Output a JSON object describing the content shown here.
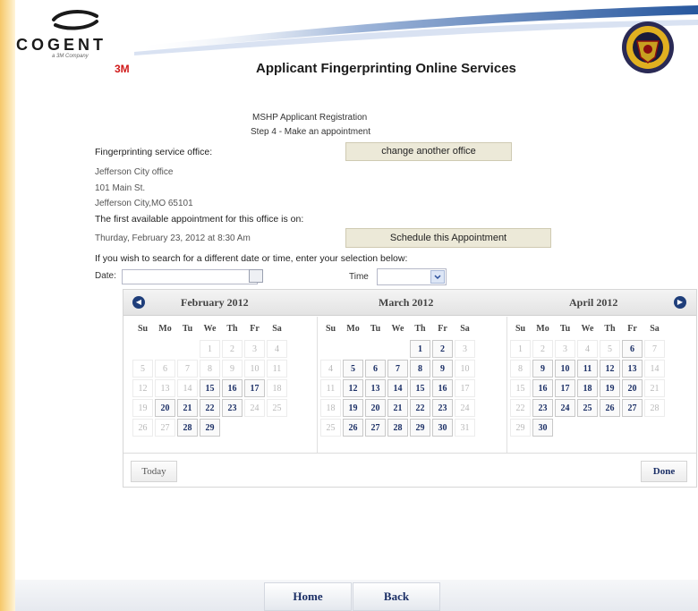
{
  "header": {
    "logo_text": "COGENT",
    "logo_sub": "a 3M Company",
    "logo_3m": "3M",
    "app_title": "Applicant Fingerprinting Online Services"
  },
  "page": {
    "heading": "MSHP Applicant Registration",
    "step": "Step 4 - Make an appointment"
  },
  "office": {
    "label": "Fingerprinting service office:",
    "change_button": "change another office",
    "name": "Jefferson City office",
    "street": "101 Main St.",
    "city": "Jefferson City,MO 65101"
  },
  "appointment": {
    "label": "The first available appointment for this office is on:",
    "value": "Thurday, February 23, 2012 at 8:30 Am",
    "schedule_button": "Schedule this Appointment"
  },
  "search": {
    "label": "If you wish to search for a different date or time, enter your selection below:",
    "date_label": "Date:",
    "date_value": "",
    "time_label": "Time",
    "time_value": ""
  },
  "datepicker": {
    "prev_icon": "circle-arrow-left",
    "next_icon": "circle-arrow-right",
    "weekday_labels": [
      "Su",
      "Mo",
      "Tu",
      "We",
      "Th",
      "Fr",
      "Sa"
    ],
    "months": [
      {
        "title": "February 2012",
        "weeks": [
          [
            {
              "d": "",
              "s": "empty"
            },
            {
              "d": "",
              "s": "empty"
            },
            {
              "d": "",
              "s": "empty"
            },
            {
              "d": "1",
              "s": "dim"
            },
            {
              "d": "2",
              "s": "dim"
            },
            {
              "d": "3",
              "s": "dim"
            },
            {
              "d": "4",
              "s": "dim"
            }
          ],
          [
            {
              "d": "5",
              "s": "dim"
            },
            {
              "d": "6",
              "s": "dim"
            },
            {
              "d": "7",
              "s": "dim"
            },
            {
              "d": "8",
              "s": "dim"
            },
            {
              "d": "9",
              "s": "dim"
            },
            {
              "d": "10",
              "s": "dim"
            },
            {
              "d": "11",
              "s": "dim"
            }
          ],
          [
            {
              "d": "12",
              "s": "dim"
            },
            {
              "d": "13",
              "s": "dim"
            },
            {
              "d": "14",
              "s": "dim"
            },
            {
              "d": "15",
              "s": "avail"
            },
            {
              "d": "16",
              "s": "avail"
            },
            {
              "d": "17",
              "s": "avail"
            },
            {
              "d": "18",
              "s": "dim"
            }
          ],
          [
            {
              "d": "19",
              "s": "dim"
            },
            {
              "d": "20",
              "s": "avail"
            },
            {
              "d": "21",
              "s": "avail"
            },
            {
              "d": "22",
              "s": "avail"
            },
            {
              "d": "23",
              "s": "avail"
            },
            {
              "d": "24",
              "s": "dim"
            },
            {
              "d": "25",
              "s": "dim"
            }
          ],
          [
            {
              "d": "26",
              "s": "dim"
            },
            {
              "d": "27",
              "s": "dim"
            },
            {
              "d": "28",
              "s": "avail"
            },
            {
              "d": "29",
              "s": "avail"
            },
            {
              "d": "",
              "s": "empty"
            },
            {
              "d": "",
              "s": "empty"
            },
            {
              "d": "",
              "s": "empty"
            }
          ]
        ]
      },
      {
        "title": "March 2012",
        "weeks": [
          [
            {
              "d": "",
              "s": "empty"
            },
            {
              "d": "",
              "s": "empty"
            },
            {
              "d": "",
              "s": "empty"
            },
            {
              "d": "",
              "s": "empty"
            },
            {
              "d": "1",
              "s": "avail"
            },
            {
              "d": "2",
              "s": "avail"
            },
            {
              "d": "3",
              "s": "dim"
            }
          ],
          [
            {
              "d": "4",
              "s": "dim"
            },
            {
              "d": "5",
              "s": "avail"
            },
            {
              "d": "6",
              "s": "avail"
            },
            {
              "d": "7",
              "s": "avail"
            },
            {
              "d": "8",
              "s": "avail"
            },
            {
              "d": "9",
              "s": "avail"
            },
            {
              "d": "10",
              "s": "dim"
            }
          ],
          [
            {
              "d": "11",
              "s": "dim"
            },
            {
              "d": "12",
              "s": "avail"
            },
            {
              "d": "13",
              "s": "avail"
            },
            {
              "d": "14",
              "s": "avail"
            },
            {
              "d": "15",
              "s": "avail"
            },
            {
              "d": "16",
              "s": "avail"
            },
            {
              "d": "17",
              "s": "dim"
            }
          ],
          [
            {
              "d": "18",
              "s": "dim"
            },
            {
              "d": "19",
              "s": "avail"
            },
            {
              "d": "20",
              "s": "avail"
            },
            {
              "d": "21",
              "s": "avail"
            },
            {
              "d": "22",
              "s": "avail"
            },
            {
              "d": "23",
              "s": "avail"
            },
            {
              "d": "24",
              "s": "dim"
            }
          ],
          [
            {
              "d": "25",
              "s": "dim"
            },
            {
              "d": "26",
              "s": "avail"
            },
            {
              "d": "27",
              "s": "avail"
            },
            {
              "d": "28",
              "s": "avail"
            },
            {
              "d": "29",
              "s": "avail"
            },
            {
              "d": "30",
              "s": "avail"
            },
            {
              "d": "31",
              "s": "dim"
            }
          ]
        ]
      },
      {
        "title": "April 2012",
        "weeks": [
          [
            {
              "d": "1",
              "s": "dim"
            },
            {
              "d": "2",
              "s": "dim"
            },
            {
              "d": "3",
              "s": "dim"
            },
            {
              "d": "4",
              "s": "dim"
            },
            {
              "d": "5",
              "s": "dim"
            },
            {
              "d": "6",
              "s": "avail"
            },
            {
              "d": "7",
              "s": "dim"
            }
          ],
          [
            {
              "d": "8",
              "s": "dim"
            },
            {
              "d": "9",
              "s": "avail"
            },
            {
              "d": "10",
              "s": "avail"
            },
            {
              "d": "11",
              "s": "avail"
            },
            {
              "d": "12",
              "s": "avail"
            },
            {
              "d": "13",
              "s": "avail"
            },
            {
              "d": "14",
              "s": "dim"
            }
          ],
          [
            {
              "d": "15",
              "s": "dim"
            },
            {
              "d": "16",
              "s": "avail"
            },
            {
              "d": "17",
              "s": "avail"
            },
            {
              "d": "18",
              "s": "avail"
            },
            {
              "d": "19",
              "s": "avail"
            },
            {
              "d": "20",
              "s": "avail"
            },
            {
              "d": "21",
              "s": "dim"
            }
          ],
          [
            {
              "d": "22",
              "s": "dim"
            },
            {
              "d": "23",
              "s": "avail"
            },
            {
              "d": "24",
              "s": "avail"
            },
            {
              "d": "25",
              "s": "avail"
            },
            {
              "d": "26",
              "s": "avail"
            },
            {
              "d": "27",
              "s": "avail"
            },
            {
              "d": "28",
              "s": "dim"
            }
          ],
          [
            {
              "d": "29",
              "s": "dim"
            },
            {
              "d": "30",
              "s": "avail"
            },
            {
              "d": "",
              "s": "empty"
            },
            {
              "d": "",
              "s": "empty"
            },
            {
              "d": "",
              "s": "empty"
            },
            {
              "d": "",
              "s": "empty"
            },
            {
              "d": "",
              "s": "empty"
            }
          ]
        ]
      }
    ],
    "today_button": "Today",
    "done_button": "Done"
  },
  "footer": {
    "home_button": "Home",
    "back_button": "Back"
  },
  "colors": {
    "accent_blue": "#1f3e7a",
    "button_beige": "#ece9d8",
    "left_band": "#f6c86a",
    "brand_red": "#d01818"
  }
}
